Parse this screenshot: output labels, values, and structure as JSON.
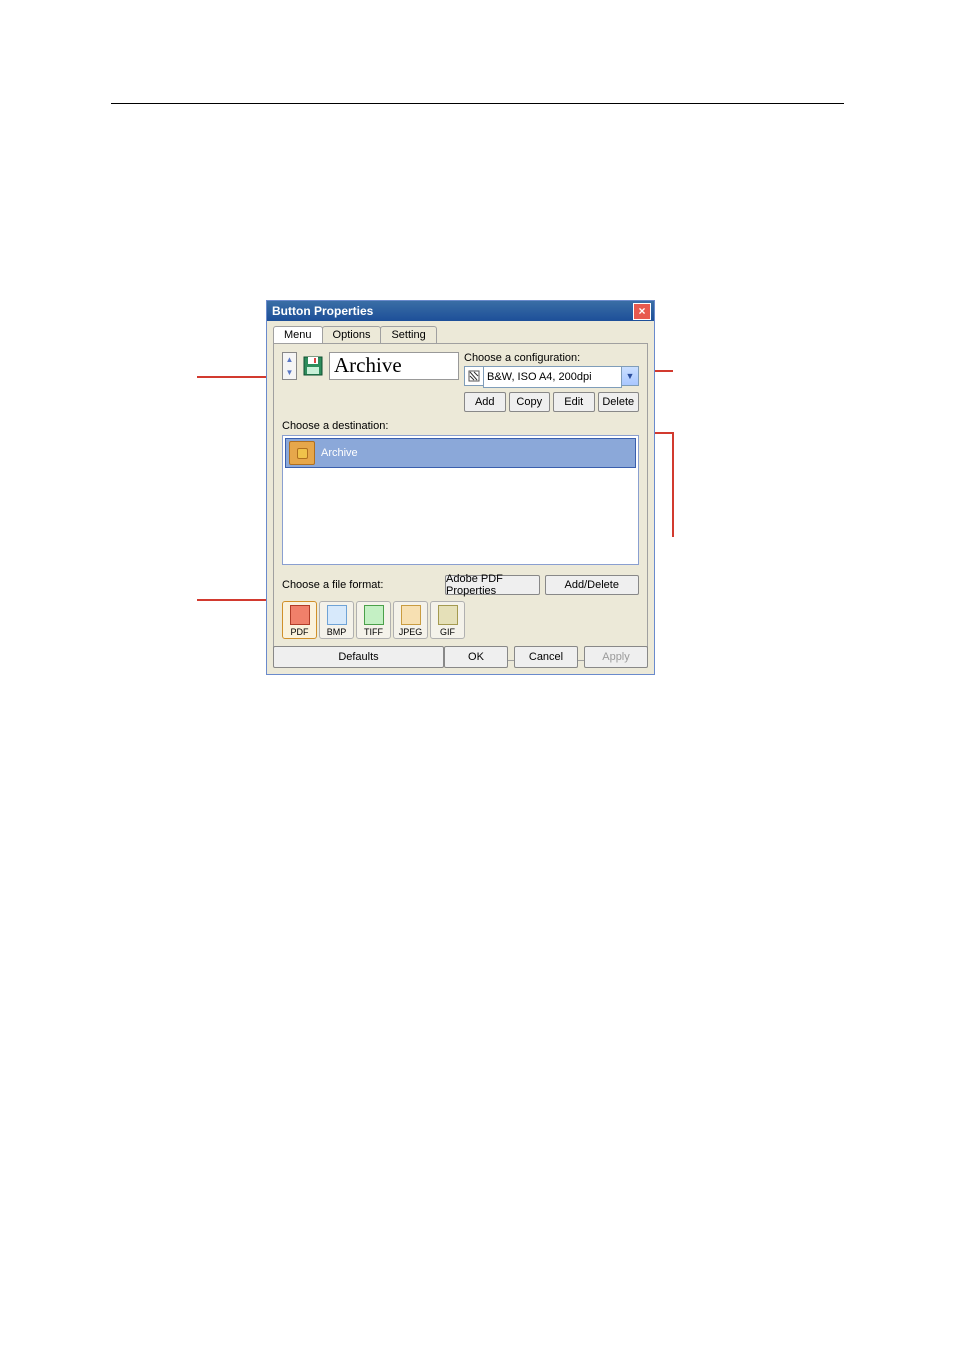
{
  "dialog": {
    "title": "Button Properties",
    "tabs": [
      "Menu",
      "Options",
      "Setting"
    ],
    "active_tab": 0,
    "name_input": "Archive",
    "config": {
      "label": "Choose a configuration:",
      "selected": "B&W, ISO A4, 200dpi",
      "buttons": [
        "Add",
        "Copy",
        "Edit",
        "Delete"
      ]
    },
    "destination": {
      "label": "Choose a destination:",
      "items": [
        "Archive"
      ]
    },
    "file_format": {
      "label": "Choose a file format:",
      "prop_button": "Adobe PDF Properties",
      "adddel_button": "Add/Delete",
      "formats": [
        "PDF",
        "BMP",
        "TIFF",
        "JPEG",
        "GIF"
      ],
      "selected": "PDF"
    },
    "footer": {
      "defaults": "Defaults",
      "ok": "OK",
      "cancel": "Cancel",
      "apply": "Apply"
    }
  }
}
